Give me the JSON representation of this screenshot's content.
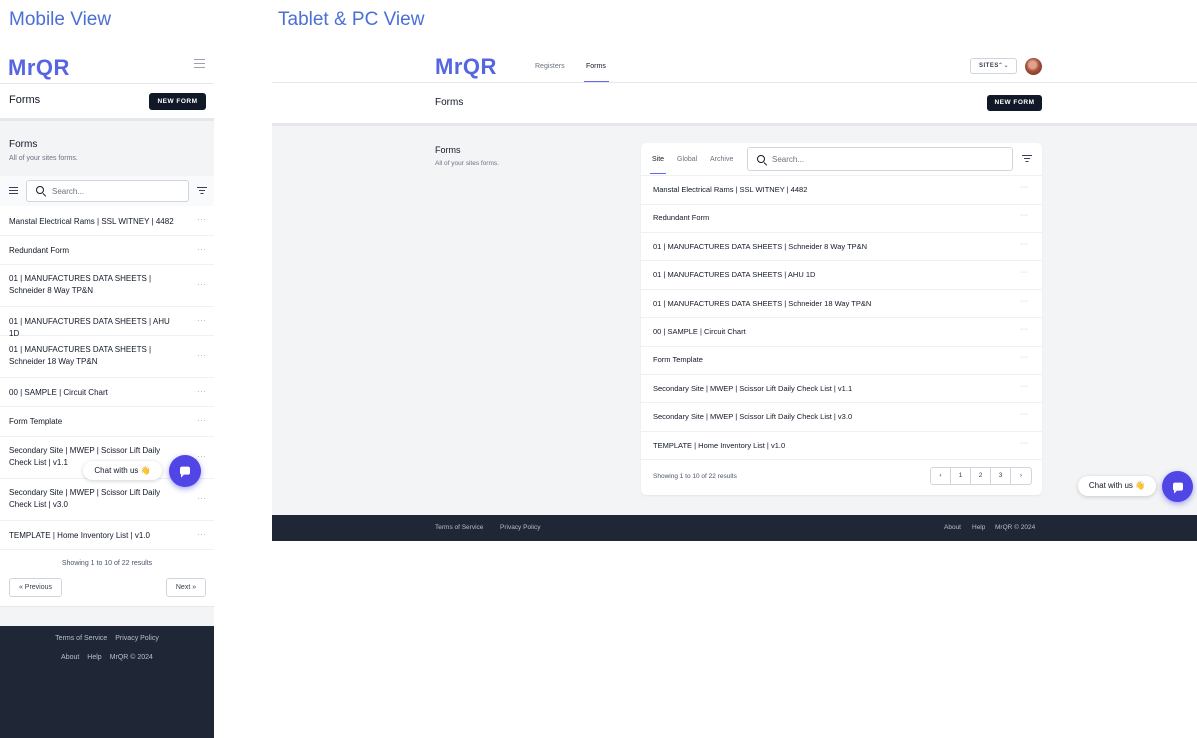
{
  "captions": {
    "mobile": "Mobile View",
    "desktop": "Tablet & PC View"
  },
  "brand": {
    "logo": "MrQR",
    "accent": "#5566e0",
    "footer_bg": "#1f2635"
  },
  "nav": {
    "registers": "Registers",
    "forms": "Forms",
    "sites": "SITES",
    "sites_arrow": "⌃⌄"
  },
  "header": {
    "title": "Forms",
    "new_form": "NEW FORM"
  },
  "section": {
    "title": "Forms",
    "subtitle": "All of your sites forms."
  },
  "tabs": [
    "Site",
    "Global",
    "Archive"
  ],
  "search": {
    "placeholder": "Search..."
  },
  "forms": [
    "Manstal Electrical Rams | SSL WITNEY | 4482",
    "Redundant Form",
    "01 | MANUFACTURES DATA SHEETS | Schneider 8 Way TP&N",
    "01 | MANUFACTURES DATA SHEETS | AHU 1D",
    "01 | MANUFACTURES DATA SHEETS | Schneider 18 Way TP&N",
    "00 | SAMPLE | Circuit Chart",
    "Form Template",
    "Secondary Site | MWEP | Scissor Lift Daily Check List | v1.1",
    "Secondary Site | MWEP | Scissor Lift Daily Check List | v3.0",
    "TEMPLATE | Home Inventory List | v1.0"
  ],
  "row_menu": "···",
  "pagination": {
    "showing_mobile": "Showing 1 to 10 of 22 results",
    "showing_desktop": "Showing 1 to 10 of 22 results",
    "previous": "« Previous",
    "next": "Next »",
    "prev_icon": "‹",
    "next_icon": "›",
    "pages": [
      "1",
      "2",
      "3"
    ]
  },
  "chat": {
    "label": "Chat with us 👋"
  },
  "footer": {
    "terms": "Terms of Service",
    "privacy": "Privacy Policy",
    "about": "About",
    "help": "Help",
    "copyright": "MrQR © 2024"
  }
}
